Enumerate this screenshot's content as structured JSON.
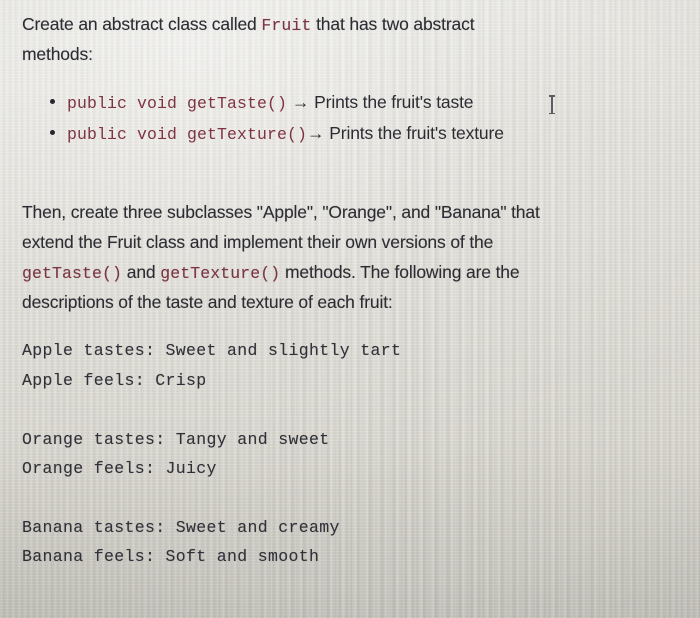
{
  "document": {
    "intro": {
      "line1_pre": "Create an abstract class called ",
      "line1_code": "Fruit",
      "line1_post": " that has two abstract",
      "line2": "methods:"
    },
    "bullets": [
      {
        "code": "public void getTaste()",
        "arrow": "→",
        "description": "Prints the fruit's taste"
      },
      {
        "code": "public void getTexture()",
        "arrow": "→",
        "description": "Prints the fruit's texture"
      }
    ],
    "paragraph": {
      "line1": "Then, create three subclasses \"Apple\", \"Orange\", and \"Banana\" that",
      "line2": "extend the Fruit class and implement their own versions of the",
      "line3_code_a": "getTaste()",
      "line3_mid": " and ",
      "line3_code_b": "getTexture()",
      "line3_post": " methods. The following are the",
      "line4": "descriptions of the taste and texture of each fruit:"
    },
    "fruit_specs": [
      {
        "taste_line": "Apple tastes: Sweet and slightly tart",
        "feels_line": "Apple feels: Crisp"
      },
      {
        "taste_line": "Orange tastes: Tangy and sweet",
        "feels_line": "Orange feels: Juicy"
      },
      {
        "taste_line": "Banana tastes: Sweet and creamy",
        "feels_line": "Banana feels: Soft and smooth"
      }
    ],
    "colors": {
      "code_text": "#7e3340",
      "body_text": "#2c2c32",
      "mono_text": "#303038",
      "background": "#dedcd5"
    }
  }
}
